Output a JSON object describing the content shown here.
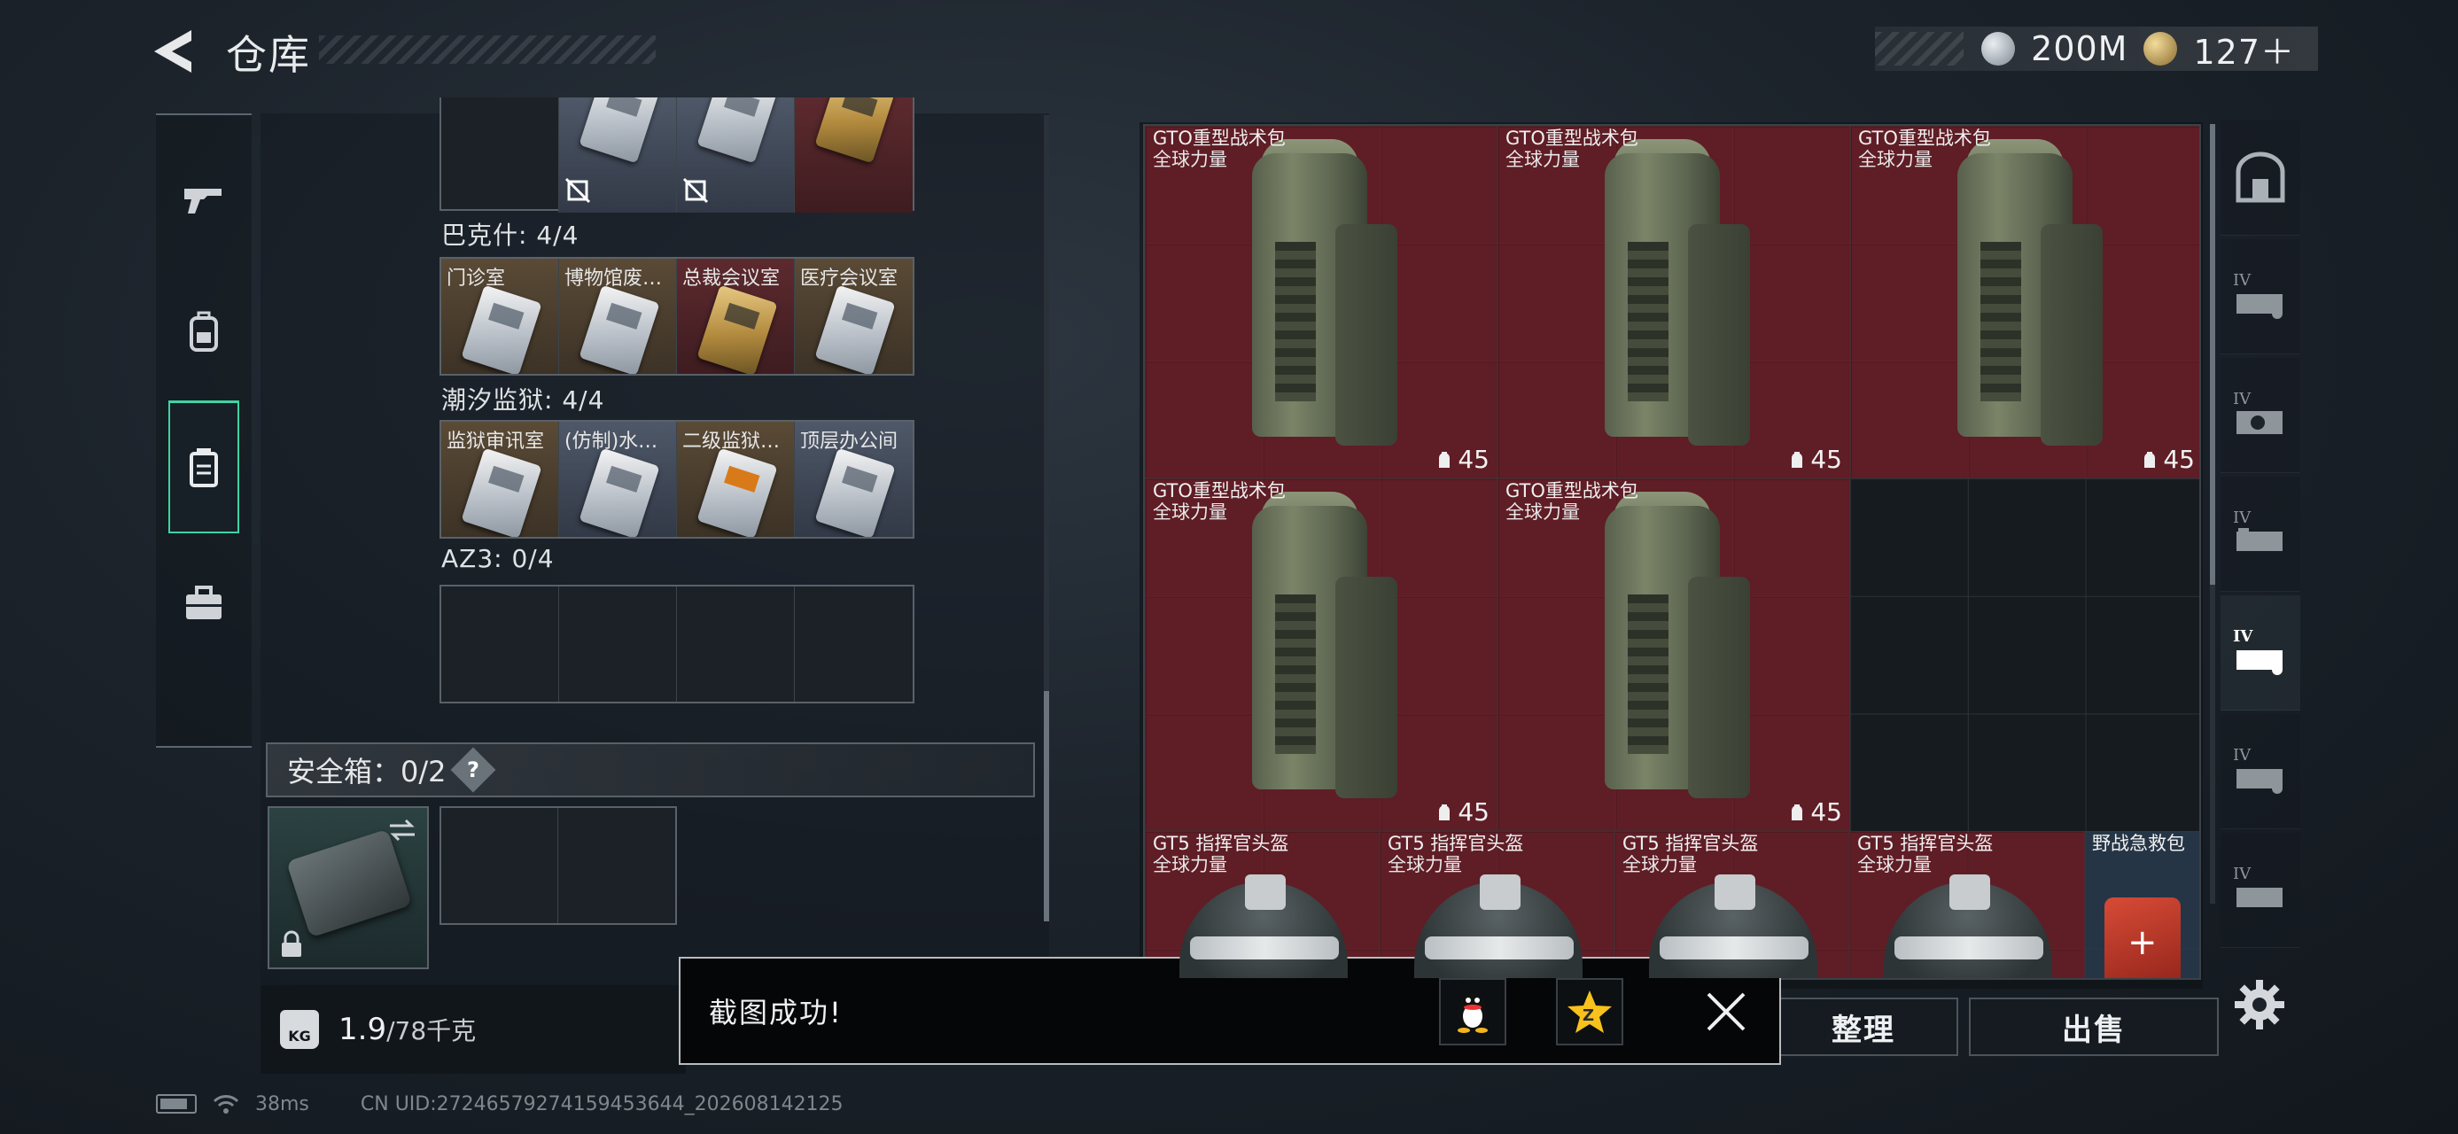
{
  "header": {
    "back_icon": "chevron-left-icon",
    "title": "仓库"
  },
  "currency": {
    "coin_a_icon": "silver-coin-icon",
    "coin_a": "200M",
    "coin_b_icon": "gold-coin-icon",
    "coin_b": "127＋"
  },
  "left_tabs": [
    {
      "icon": "pistol-icon",
      "active": false
    },
    {
      "icon": "backpack-icon",
      "active": false
    },
    {
      "icon": "storage-case-icon",
      "active": true
    },
    {
      "icon": "toolbox-icon",
      "active": false
    }
  ],
  "key_groups": [
    {
      "title": "",
      "cells": [
        {
          "label": "",
          "style": "empty"
        },
        {
          "label": "",
          "style": "slate",
          "unusable": true
        },
        {
          "label": "",
          "style": "slate",
          "unusable": true
        },
        {
          "label": "",
          "style": "red-gold"
        }
      ]
    },
    {
      "title": "巴克什: 4/4",
      "cells": [
        {
          "label": "门诊室",
          "style": "tan"
        },
        {
          "label": "博物馆废…",
          "style": "tan"
        },
        {
          "label": "总裁会议室",
          "style": "red-gold"
        },
        {
          "label": "医疗会议室",
          "style": "tan"
        }
      ]
    },
    {
      "title": "潮汐监狱: 4/4",
      "cells": [
        {
          "label": "监狱审讯室",
          "style": "tan"
        },
        {
          "label": "(仿制)水…",
          "style": "slate"
        },
        {
          "label": "二级监狱…",
          "style": "tan-orange"
        },
        {
          "label": "顶层办公间",
          "style": "slate"
        }
      ]
    },
    {
      "title": "AZ3: 0/4",
      "cells": [
        {
          "label": "",
          "style": "empty"
        },
        {
          "label": "",
          "style": "empty"
        },
        {
          "label": "",
          "style": "empty"
        },
        {
          "label": "",
          "style": "empty"
        }
      ]
    }
  ],
  "safe_box": {
    "label": "安全箱：0/2",
    "help": "?",
    "swap_icon": "swap-icon",
    "lock_icon": "lock-icon"
  },
  "weight": {
    "icon_text": "KG",
    "current": "1.9",
    "max": "/78千克"
  },
  "inventory": [
    {
      "name": "GTO重型战术包",
      "sub": "全球力量",
      "durability": "45",
      "kind": "backpack"
    },
    {
      "name": "GTO重型战术包",
      "sub": "全球力量",
      "durability": "45",
      "kind": "backpack"
    },
    {
      "name": "GTO重型战术包",
      "sub": "全球力量",
      "durability": "45",
      "kind": "backpack"
    },
    {
      "name": "GTO重型战术包",
      "sub": "全球力量",
      "durability": "45",
      "kind": "backpack"
    },
    {
      "name": "GTO重型战术包",
      "sub": "全球力量",
      "durability": "45",
      "kind": "backpack"
    },
    {
      "name": "GT5 指挥官头盔",
      "sub": "全球力量",
      "durability": "",
      "kind": "helmet"
    },
    {
      "name": "GT5 指挥官头盔",
      "sub": "全球力量",
      "durability": "",
      "kind": "helmet"
    },
    {
      "name": "GT5 指挥官头盔",
      "sub": "全球力量",
      "durability": "",
      "kind": "helmet"
    },
    {
      "name": "GT5 指挥官头盔",
      "sub": "全球力量",
      "durability": "",
      "kind": "helmet"
    },
    {
      "name": "野战急救包",
      "sub": "",
      "durability": "",
      "kind": "medkit"
    }
  ],
  "right_tabs": [
    {
      "icon": "vault-icon",
      "label": ""
    },
    {
      "icon": "tier-iv-case-icon",
      "label": "IV"
    },
    {
      "icon": "tier-iv-camera-case-icon",
      "label": "IV"
    },
    {
      "icon": "tier-iv-case-icon",
      "label": "IV"
    },
    {
      "icon": "tier-iv-case-active-icon",
      "label": "IV"
    },
    {
      "icon": "tier-iv-case-icon",
      "label": "IV"
    },
    {
      "icon": "tier-iv-case-icon",
      "label": "IV"
    }
  ],
  "buttons": {
    "sort": "整理",
    "sell": "出售",
    "settings_icon": "gear-icon"
  },
  "toast": {
    "message": "截图成功!",
    "qq_icon": "qq-penguin-icon",
    "qzone_icon": "qzone-star-icon",
    "close_icon": "close-icon"
  },
  "status": {
    "battery_icon": "battery-icon",
    "wifi_icon": "wifi-icon",
    "ping": "38ms",
    "uid": "CN UID:27246579274159453644_202608142125"
  },
  "colors": {
    "accent_green": "#41d3a3",
    "item_red": "#7c1e28",
    "panel_dark": "#161b20"
  }
}
